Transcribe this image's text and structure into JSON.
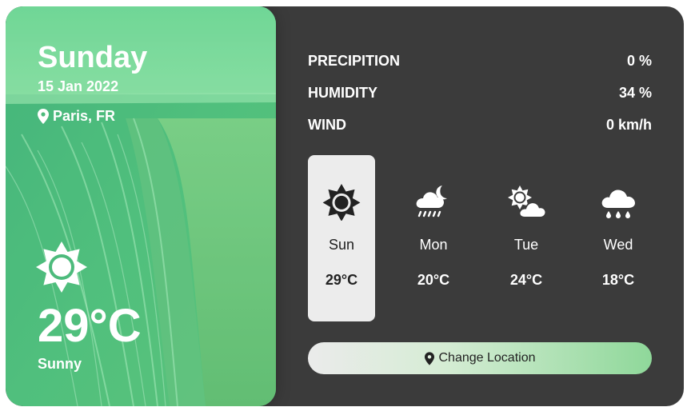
{
  "current": {
    "day": "Sunday",
    "date": "15 Jan 2022",
    "location": "Paris, FR",
    "temperature": "29°C",
    "condition": "Sunny",
    "icon": "sun-icon"
  },
  "stats": [
    {
      "label": "PRECIPITION",
      "value": "0 %"
    },
    {
      "label": "HUMIDITY",
      "value": "34 %"
    },
    {
      "label": "WIND",
      "value": "0 km/h"
    }
  ],
  "forecast": [
    {
      "day": "Sun",
      "temp": "29°C",
      "icon": "sun-icon",
      "active": true
    },
    {
      "day": "Mon",
      "temp": "20°C",
      "icon": "cloud-moon-rain-icon",
      "active": false
    },
    {
      "day": "Tue",
      "temp": "24°C",
      "icon": "cloud-sun-icon",
      "active": false
    },
    {
      "day": "Wed",
      "temp": "18°C",
      "icon": "cloud-rain-icon",
      "active": false
    }
  ],
  "change_location_label": "Change Location",
  "colors": {
    "panel_dark": "#3b3b3b",
    "green_overlay": "#5fd485",
    "active_day_bg": "#ececec",
    "button_gradient_end": "#8fd89a"
  }
}
